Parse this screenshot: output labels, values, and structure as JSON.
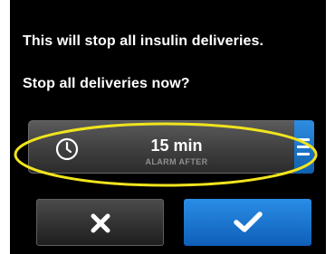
{
  "dialog": {
    "message": "This will stop all insulin deliveries.",
    "question": "Stop all deliveries now?"
  },
  "alarm_selector": {
    "value": "15 min",
    "label": "ALARM AFTER"
  },
  "icons": {
    "timer": "clock-icon",
    "scroll": "scroll-list-icon",
    "cancel": "x-icon",
    "confirm": "checkmark-icon"
  },
  "colors": {
    "background": "#000000",
    "text": "#ffffff",
    "accent": "#1a73c8",
    "highlight": "#f0e41e"
  }
}
